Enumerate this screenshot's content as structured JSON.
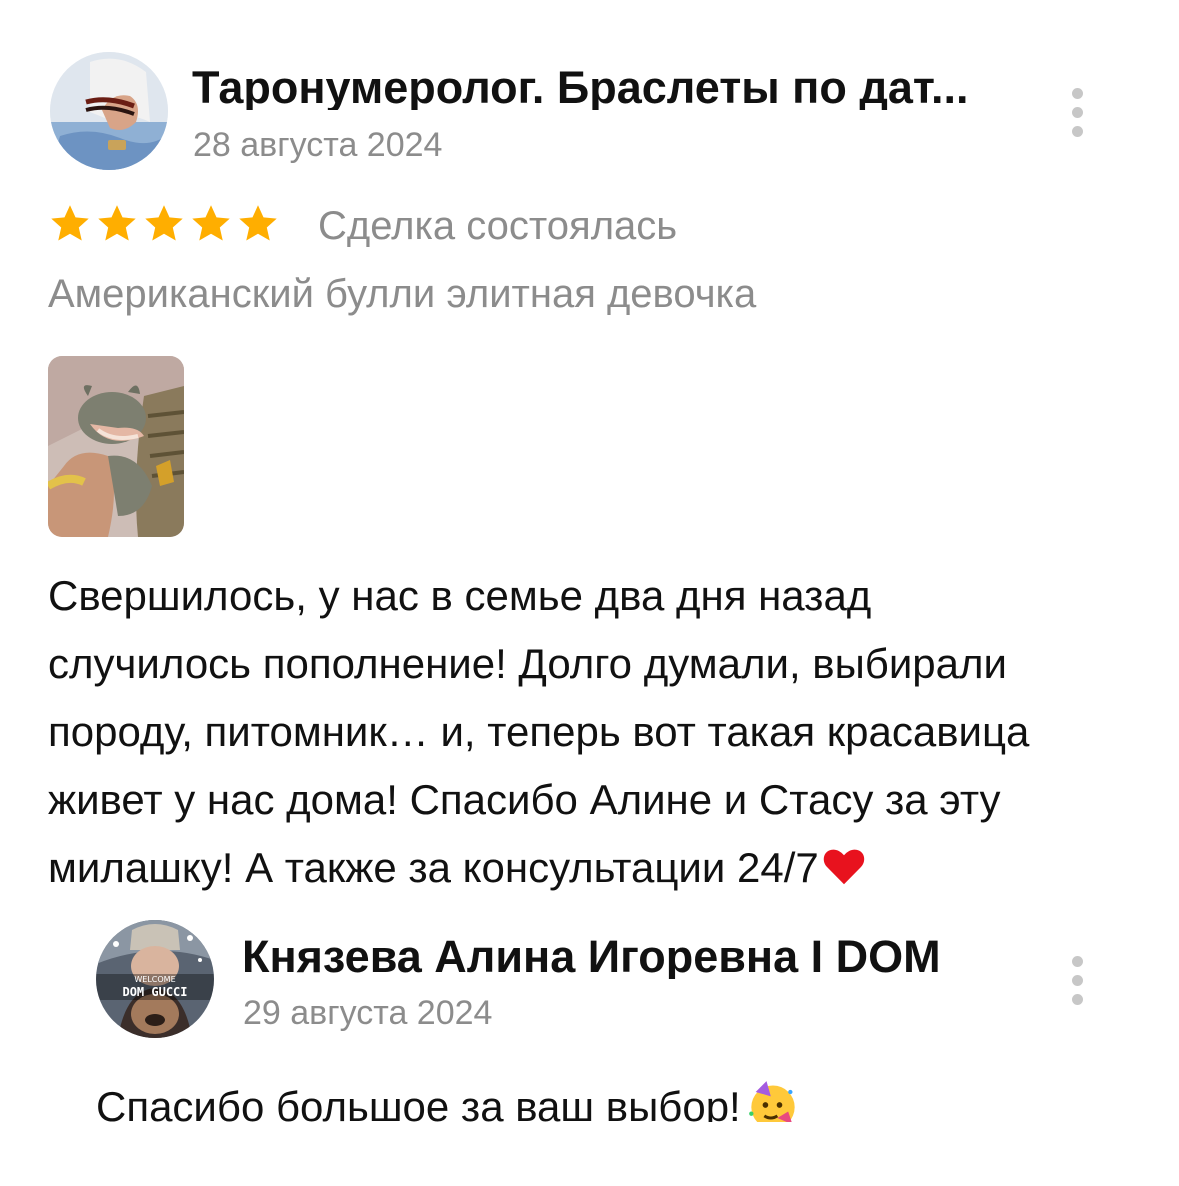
{
  "review": {
    "author": "Таронумеролог. Браслеты по дат...",
    "date": "28 августа 2024",
    "rating": 5,
    "max_rating": 5,
    "deal_status": "Сделка состоялась",
    "product": "Американский булли элитная девочка",
    "text_lines": [
      "Свершилось, у нас в семье два дня назад",
      "случилось пополнение! Долго думали, выбирали",
      "породу, питомник… и, теперь вот такая красавица",
      "живет у нас дома! Спасибо Алине и Стасу за эту",
      "милашку! А также за консультации 24/7"
    ],
    "text_end_icon": "red-heart-icon"
  },
  "reply": {
    "author": "Князева Алина Игоревна I DOM",
    "date": "29 августа 2024",
    "avatar_text": [
      "WELCOME",
      "DOM GUCCI"
    ],
    "text": "Спасибо большое за ваш выбор!",
    "text_end_icon": "partying-face-icon"
  },
  "colors": {
    "star": "#FFAE00",
    "secondary_text": "#8C8C8C",
    "primary_text": "#111111",
    "more_dots": "#C7C7C7"
  }
}
